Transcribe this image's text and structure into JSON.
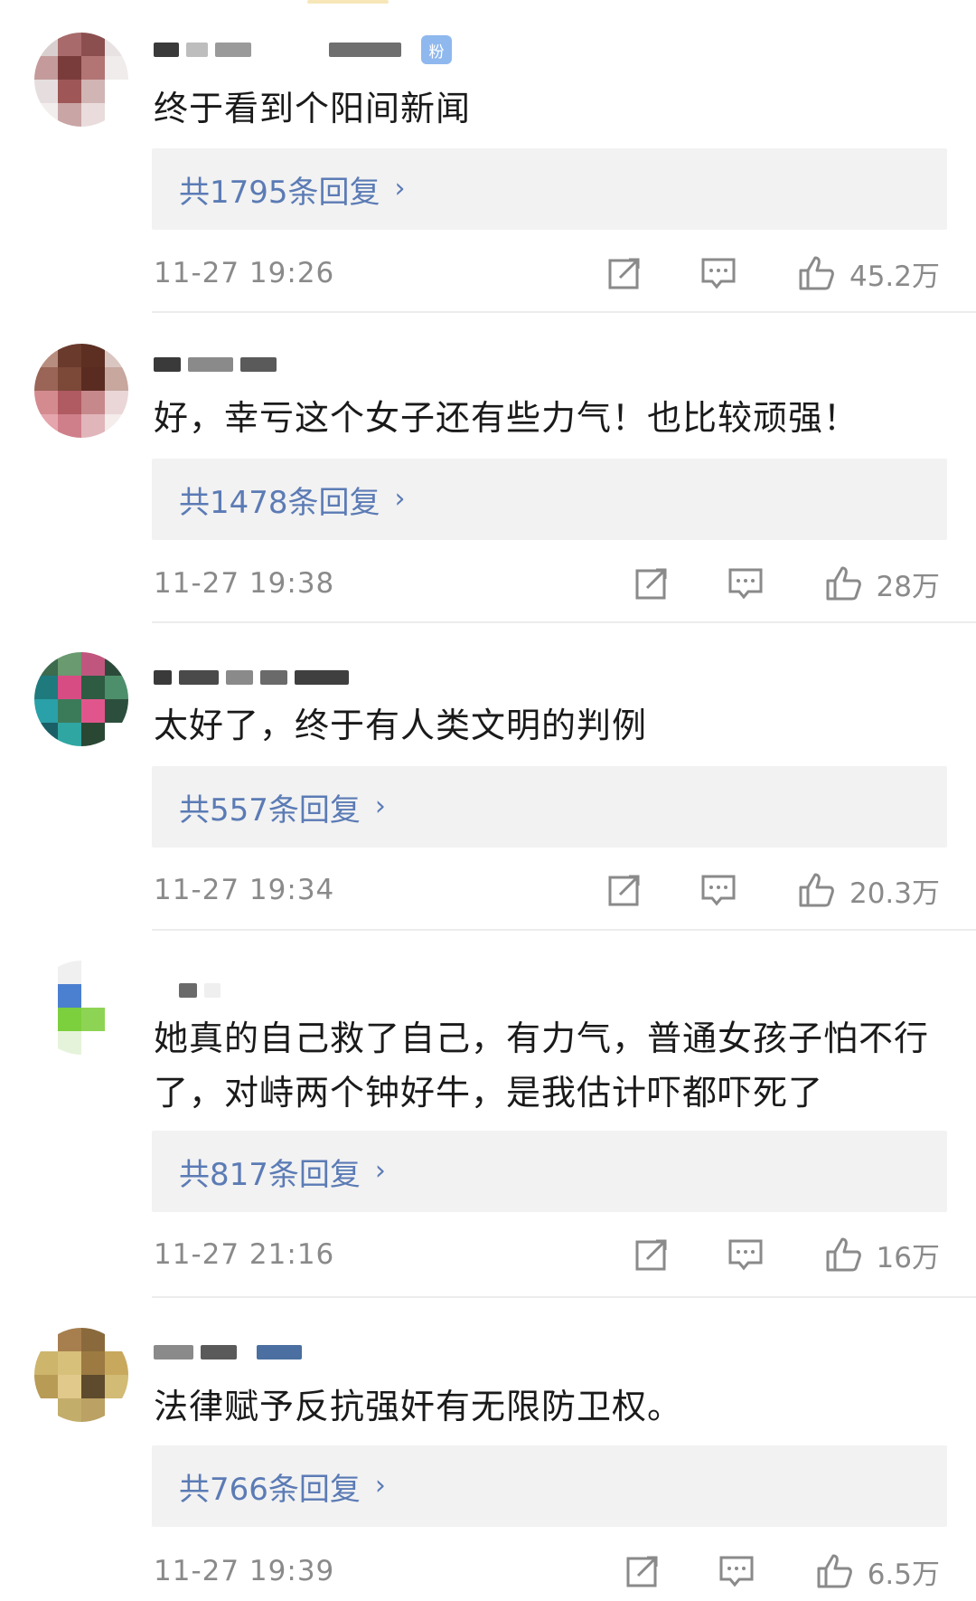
{
  "comments": [
    {
      "badge": "粉",
      "text": "终于看到个阳间新闻",
      "replies_label": "共1795条回复",
      "time": "11-27 19:26",
      "likes": "45.2万"
    },
    {
      "text": "好，幸亏这个女子还有些力气！也比较顽强！",
      "replies_label": "共1478条回复",
      "time": "11-27 19:38",
      "likes": "28万"
    },
    {
      "text": "太好了，终于有人类文明的判例",
      "replies_label": "共557条回复",
      "time": "11-27 19:34",
      "likes": "20.3万"
    },
    {
      "text": "她真的自己救了自己，有力气，普通女孩子怕不行了，对峙两个钟好牛，是我估计吓都吓死了",
      "replies_label": "共817条回复",
      "time": "11-27 21:16",
      "likes": "16万"
    },
    {
      "text": "法律赋予反抗强奸有无限防卫权。",
      "replies_label": "共766条回复",
      "time": "11-27 19:39",
      "likes": "6.5万"
    }
  ],
  "chevron": "›",
  "icons": {
    "share": "share-icon",
    "reply": "comment-icon",
    "like": "thumbs-up-icon"
  },
  "colors": {
    "reply_link": "#5b7bb5",
    "meta_gray": "#8a8a8a",
    "reply_box_bg": "#f2f2f2",
    "badge_bg": "#8fb8ee"
  }
}
